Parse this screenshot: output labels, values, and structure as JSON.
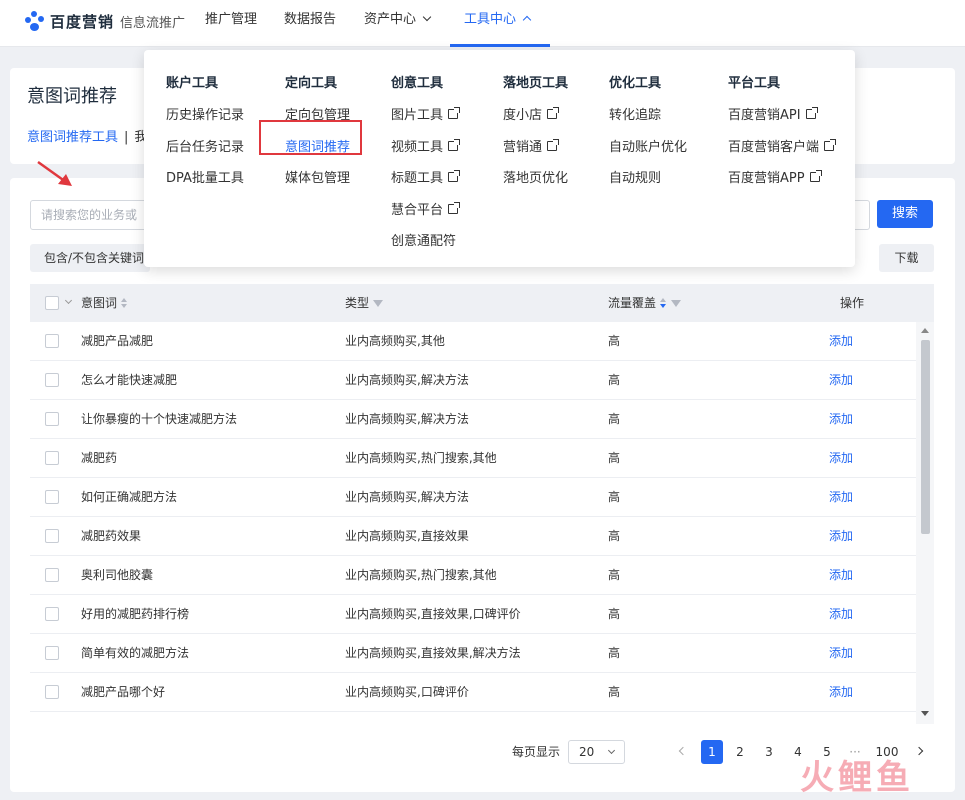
{
  "topnav": {
    "brand": "百度营销",
    "brand_sub": "信息流推广",
    "items": [
      {
        "label": "推广管理"
      },
      {
        "label": "数据报告"
      },
      {
        "label": "资产中心"
      },
      {
        "label": "工具中心"
      }
    ],
    "active_color": "#2468f2"
  },
  "page": {
    "title": "意图词推荐",
    "breadcrumb_link": "意图词推荐工具",
    "breadcrumb_sep": "|",
    "breadcrumb_current": "我"
  },
  "toolbar": {
    "search_placeholder": "请搜索您的业务或",
    "search_label": "搜索",
    "filter_label": "包含/不包含关键词",
    "download_label": "下载"
  },
  "mega_menu": {
    "columns": [
      {
        "title": "账户工具",
        "items": [
          {
            "label": "历史操作记录"
          },
          {
            "label": "后台任务记录"
          },
          {
            "label": "DPA批量工具"
          }
        ]
      },
      {
        "title": "定向工具",
        "items": [
          {
            "label": "定向包管理"
          },
          {
            "label": "意图词推荐",
            "selected": true
          },
          {
            "label": "媒体包管理"
          }
        ]
      },
      {
        "title": "创意工具",
        "items": [
          {
            "label": "图片工具",
            "external": true
          },
          {
            "label": "视频工具",
            "external": true
          },
          {
            "label": "标题工具",
            "external": true
          },
          {
            "label": "慧合平台",
            "external": true
          },
          {
            "label": "创意通配符"
          }
        ]
      },
      {
        "title": "落地页工具",
        "items": [
          {
            "label": "度小店",
            "external": true
          },
          {
            "label": "营销通",
            "external": true
          },
          {
            "label": "落地页优化"
          }
        ]
      },
      {
        "title": "优化工具",
        "items": [
          {
            "label": "转化追踪"
          },
          {
            "label": "自动账户优化"
          },
          {
            "label": "自动规则"
          }
        ]
      },
      {
        "title": "平台工具",
        "items": [
          {
            "label": "百度营销API",
            "external": true
          },
          {
            "label": "百度营销客户端",
            "external": true
          },
          {
            "label": "百度营销APP",
            "external": true
          }
        ]
      }
    ],
    "highlight_color": "#e0383e"
  },
  "table": {
    "headers": {
      "keyword": "意图词",
      "type": "类型",
      "coverage": "流量覆盖",
      "action": "操作"
    },
    "rows": [
      {
        "keyword": "减肥产品减肥",
        "type": "业内高频购买,其他",
        "coverage": "高",
        "action": "添加"
      },
      {
        "keyword": "怎么才能快速减肥",
        "type": "业内高频购买,解决方法",
        "coverage": "高",
        "action": "添加"
      },
      {
        "keyword": "让你暴瘦的十个快速减肥方法",
        "type": "业内高频购买,解决方法",
        "coverage": "高",
        "action": "添加"
      },
      {
        "keyword": "减肥药",
        "type": "业内高频购买,热门搜索,其他",
        "coverage": "高",
        "action": "添加"
      },
      {
        "keyword": "如何正确减肥方法",
        "type": "业内高频购买,解决方法",
        "coverage": "高",
        "action": "添加"
      },
      {
        "keyword": "减肥药效果",
        "type": "业内高频购买,直接效果",
        "coverage": "高",
        "action": "添加"
      },
      {
        "keyword": "奥利司他胶囊",
        "type": "业内高频购买,热门搜索,其他",
        "coverage": "高",
        "action": "添加"
      },
      {
        "keyword": "好用的减肥药排行榜",
        "type": "业内高频购买,直接效果,口碑评价",
        "coverage": "高",
        "action": "添加"
      },
      {
        "keyword": "简单有效的减肥方法",
        "type": "业内高频购买,直接效果,解决方法",
        "coverage": "高",
        "action": "添加"
      },
      {
        "keyword": "减肥产品哪个好",
        "type": "业内高频购买,口碑评价",
        "coverage": "高",
        "action": "添加"
      }
    ]
  },
  "pagination": {
    "per_page_label": "每页显示",
    "per_page_value": "20",
    "pages": [
      "1",
      "2",
      "3",
      "4",
      "5",
      "···",
      "100"
    ],
    "current": "1"
  },
  "watermark": {
    "text": "火鲤鱼"
  }
}
